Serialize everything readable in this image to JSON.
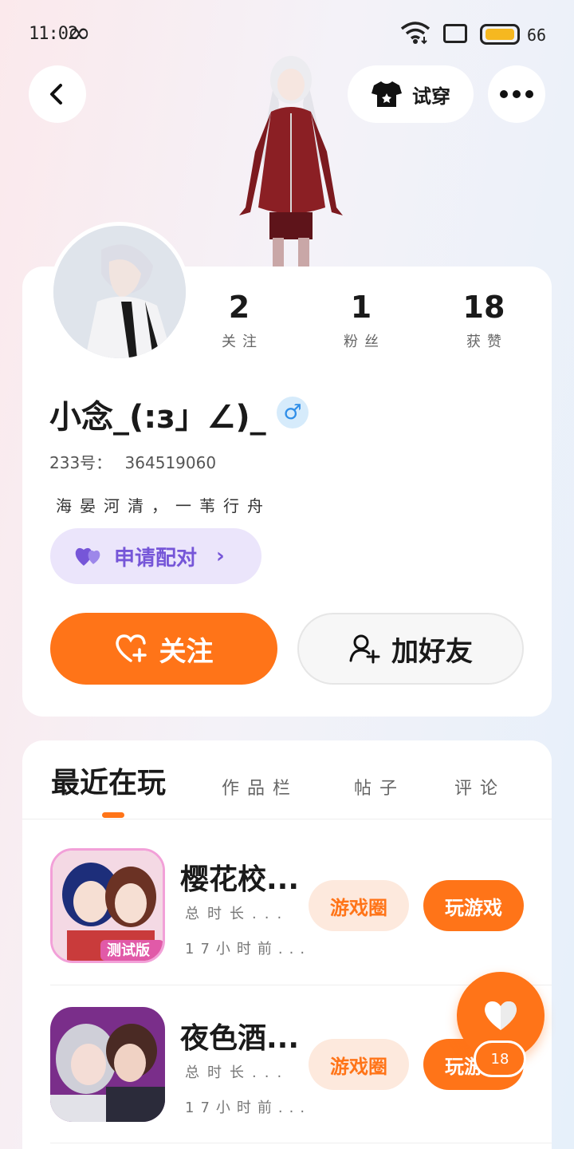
{
  "status_bar": {
    "time": "11:02",
    "battery": "66"
  },
  "header": {
    "tryon_label": "试穿"
  },
  "profile": {
    "stats": [
      {
        "value": "2",
        "label": "关注"
      },
      {
        "value": "1",
        "label": "粉丝"
      },
      {
        "value": "18",
        "label": "获赞"
      }
    ],
    "username": "小念_(:з」∠)_",
    "gender_symbol": "♂",
    "id_label": "233号：",
    "id_value": "364519060",
    "motto": "海晏河清，一苇行舟",
    "pair_label": "申请配对",
    "follow_label": "关注",
    "add_friend_label": "加好友"
  },
  "tabs": {
    "active": "最近在玩",
    "items": [
      "作品栏",
      "帖子",
      "评论"
    ]
  },
  "games": [
    {
      "title": "樱花校...",
      "total_time": "总时长...",
      "last_played": "17小时前...",
      "badge": "测试版",
      "circle_label": "游戏圈",
      "play_label": "玩游戏"
    },
    {
      "title": "夜色酒...",
      "total_time": "总时长...",
      "last_played": "17小时前...",
      "circle_label": "游戏圈",
      "play_label": "玩游戏"
    }
  ],
  "like_fab": {
    "count": "18"
  },
  "colors": {
    "accent": "#ff7418",
    "pair_purple": "#7656d8",
    "gender_blue": "#2f8ee8"
  }
}
